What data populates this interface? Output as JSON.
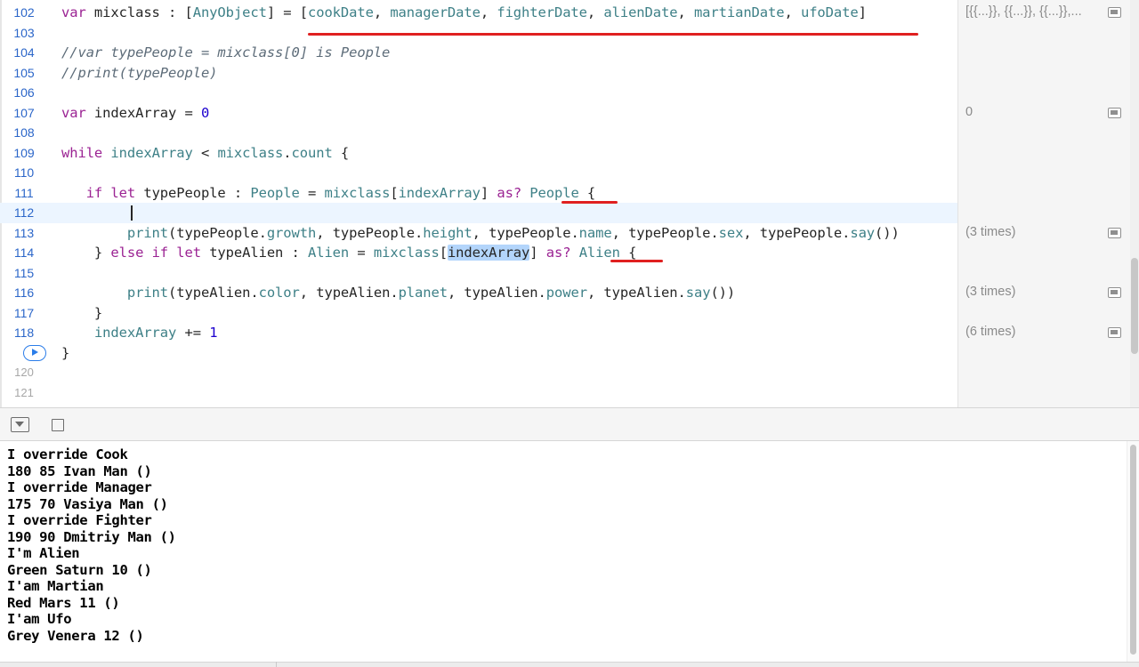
{
  "editor": {
    "lines": [
      {
        "num": "102",
        "code": [
          {
            "t": "var",
            "c": "kw"
          },
          {
            "t": " mixclass : ["
          },
          {
            "t": "AnyObject",
            "c": "ty"
          },
          {
            "t": "] = ["
          },
          {
            "t": "cookDate",
            "c": "ty"
          },
          {
            "t": ", "
          },
          {
            "t": "managerDate",
            "c": "ty"
          },
          {
            "t": ", "
          },
          {
            "t": "fighterDate",
            "c": "ty"
          },
          {
            "t": ", "
          },
          {
            "t": "alienDate",
            "c": "ty"
          },
          {
            "t": ", "
          },
          {
            "t": "martianDate",
            "c": "ty"
          },
          {
            "t": ", "
          },
          {
            "t": "ufoDate",
            "c": "ty"
          },
          {
            "t": "]"
          }
        ]
      },
      {
        "num": "103",
        "code": []
      },
      {
        "num": "104",
        "code": [
          {
            "t": "//var typePeople = mixclass[0] is People",
            "c": "cm"
          }
        ]
      },
      {
        "num": "105",
        "code": [
          {
            "t": "//print(typePeople)",
            "c": "cm"
          }
        ]
      },
      {
        "num": "106",
        "code": []
      },
      {
        "num": "107",
        "code": [
          {
            "t": "var",
            "c": "kw"
          },
          {
            "t": " indexArray = "
          },
          {
            "t": "0",
            "c": "num"
          }
        ]
      },
      {
        "num": "108",
        "code": []
      },
      {
        "num": "109",
        "code": [
          {
            "t": "while",
            "c": "kw"
          },
          {
            "t": " "
          },
          {
            "t": "indexArray",
            "c": "ty"
          },
          {
            "t": " < "
          },
          {
            "t": "mixclass",
            "c": "ty"
          },
          {
            "t": "."
          },
          {
            "t": "count",
            "c": "ty"
          },
          {
            "t": " {"
          }
        ]
      },
      {
        "num": "110",
        "code": []
      },
      {
        "num": "111",
        "code": [
          {
            "t": "   "
          },
          {
            "t": "if let",
            "c": "kw"
          },
          {
            "t": " typePeople : "
          },
          {
            "t": "People",
            "c": "ty"
          },
          {
            "t": " = "
          },
          {
            "t": "mixclass",
            "c": "ty"
          },
          {
            "t": "["
          },
          {
            "t": "indexArray",
            "c": "ty"
          },
          {
            "t": "] "
          },
          {
            "t": "as?",
            "c": "kw"
          },
          {
            "t": " "
          },
          {
            "t": "People",
            "c": "ty"
          },
          {
            "t": " {"
          }
        ]
      },
      {
        "num": "112",
        "code": [],
        "current": true
      },
      {
        "num": "113",
        "code": [
          {
            "t": "        "
          },
          {
            "t": "print",
            "c": "ty"
          },
          {
            "t": "(typePeople."
          },
          {
            "t": "growth",
            "c": "ty"
          },
          {
            "t": ", typePeople."
          },
          {
            "t": "height",
            "c": "ty"
          },
          {
            "t": ", typePeople."
          },
          {
            "t": "name",
            "c": "ty"
          },
          {
            "t": ", typePeople."
          },
          {
            "t": "sex",
            "c": "ty"
          },
          {
            "t": ", typePeople."
          },
          {
            "t": "say",
            "c": "ty"
          },
          {
            "t": "())"
          }
        ]
      },
      {
        "num": "114",
        "code": [
          {
            "t": "    } "
          },
          {
            "t": "else if let",
            "c": "kw"
          },
          {
            "t": " typeAlien : "
          },
          {
            "t": "Alien",
            "c": "ty"
          },
          {
            "t": " = "
          },
          {
            "t": "mixclass",
            "c": "ty"
          },
          {
            "t": "["
          },
          {
            "t": "indexArray",
            "c": "sel"
          },
          {
            "t": "] "
          },
          {
            "t": "as?",
            "c": "kw"
          },
          {
            "t": " "
          },
          {
            "t": "Alien",
            "c": "ty"
          },
          {
            "t": " {"
          }
        ]
      },
      {
        "num": "115",
        "code": []
      },
      {
        "num": "116",
        "code": [
          {
            "t": "        "
          },
          {
            "t": "print",
            "c": "ty"
          },
          {
            "t": "(typeAlien."
          },
          {
            "t": "color",
            "c": "ty"
          },
          {
            "t": ", typeAlien."
          },
          {
            "t": "planet",
            "c": "ty"
          },
          {
            "t": ", typeAlien."
          },
          {
            "t": "power",
            "c": "ty"
          },
          {
            "t": ", typeAlien."
          },
          {
            "t": "say",
            "c": "ty"
          },
          {
            "t": "())"
          }
        ]
      },
      {
        "num": "117",
        "code": [
          {
            "t": "    }"
          }
        ]
      },
      {
        "num": "118",
        "code": [
          {
            "t": "    "
          },
          {
            "t": "indexArray",
            "c": "ty"
          },
          {
            "t": " += "
          },
          {
            "t": "1",
            "c": "num"
          }
        ]
      },
      {
        "num": "",
        "code": [
          {
            "t": "}"
          }
        ],
        "run": true
      },
      {
        "num": "120",
        "code": [],
        "dim": true
      },
      {
        "num": "121",
        "code": [],
        "dim": true
      }
    ],
    "results": [
      {
        "line": 0,
        "text": "[{{...}}, {{...}}, {{...}},..."
      },
      {
        "line": 5,
        "text": "0"
      },
      {
        "line": 11,
        "text": "(3 times)"
      },
      {
        "line": 14,
        "text": "(3 times)"
      },
      {
        "line": 16,
        "text": "(6 times)"
      }
    ]
  },
  "console": {
    "output": [
      "I override Cook",
      "180 85 Ivan Man ()",
      "I override Manager",
      "175 70 Vasiya Man ()",
      "I override Fighter",
      "190 90 Dmitriy Man ()",
      "I'm Alien",
      "Green Saturn 10 ()",
      "I'am Martian",
      "Red Mars 11 ()",
      "I'am Ufo",
      "Grey Venera 12 ()"
    ]
  },
  "colors": {
    "keyword": "#9b2393",
    "type": "#3e8087",
    "comment": "#5d6c79",
    "number": "#1c00cf",
    "line_number": "#2b66c9",
    "annotation_red": "#e02020",
    "current_line": "#ecf5ff"
  },
  "icons": [
    "run-button-icon",
    "quick-look-icon",
    "hide-debug-area-icon",
    "console-toggle-icon"
  ]
}
